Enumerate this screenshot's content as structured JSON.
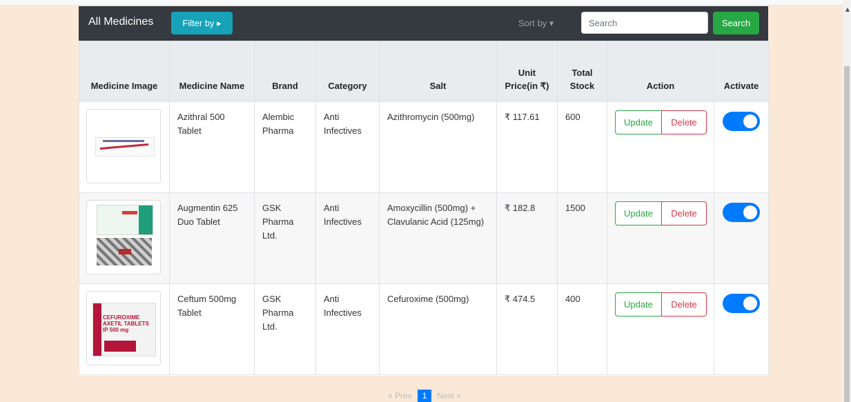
{
  "navbar": {
    "title": "All Medicines",
    "filter_label": "Filter by ▸",
    "sort_label": "Sort by ▾",
    "search_placeholder": "Search",
    "search_button": "Search"
  },
  "table": {
    "headers": [
      "Medicine Image",
      "Medicine Name",
      "Brand",
      "Category",
      "Salt",
      "Unit Price(in ₹)",
      "Total Stock",
      "Action",
      "Activate"
    ],
    "rows": [
      {
        "name": "Azithral 500 Tablet",
        "brand": "Alembic Pharma",
        "category": "Anti Infectives",
        "salt": "Azithromycin (500mg)",
        "price": "₹ 117.61",
        "stock": "600",
        "active": true
      },
      {
        "name": "Augmentin 625 Duo Tablet",
        "brand": "GSK Pharma Ltd.",
        "category": "Anti Infectives",
        "salt": "Amoxycillin (500mg) + Clavulanic Acid (125mg)",
        "price": "₹ 182.8",
        "stock": "1500",
        "active": true
      },
      {
        "name": "Ceftum 500mg Tablet",
        "brand": "GSK Pharma Ltd.",
        "category": "Anti Infectives",
        "salt": "Cefuroxime (500mg)",
        "price": "₹ 474.5",
        "stock": "400",
        "active": true
      }
    ],
    "update_label": "Update",
    "delete_label": "Delete"
  },
  "package_texts": {
    "ceftum_box": "CEFUROXIME AXETIL TABLETS IP 500 mg"
  },
  "pagination": {
    "prev": "« Prev",
    "current": "1",
    "next": "Next »"
  },
  "colors": {
    "page_bg": "#fbe9d7",
    "navbar_bg": "#343a40",
    "filter_button": "#17a2b8",
    "search_button": "#28a745",
    "toggle_on": "#007bff",
    "update": "#28a745",
    "delete": "#dc3545"
  }
}
